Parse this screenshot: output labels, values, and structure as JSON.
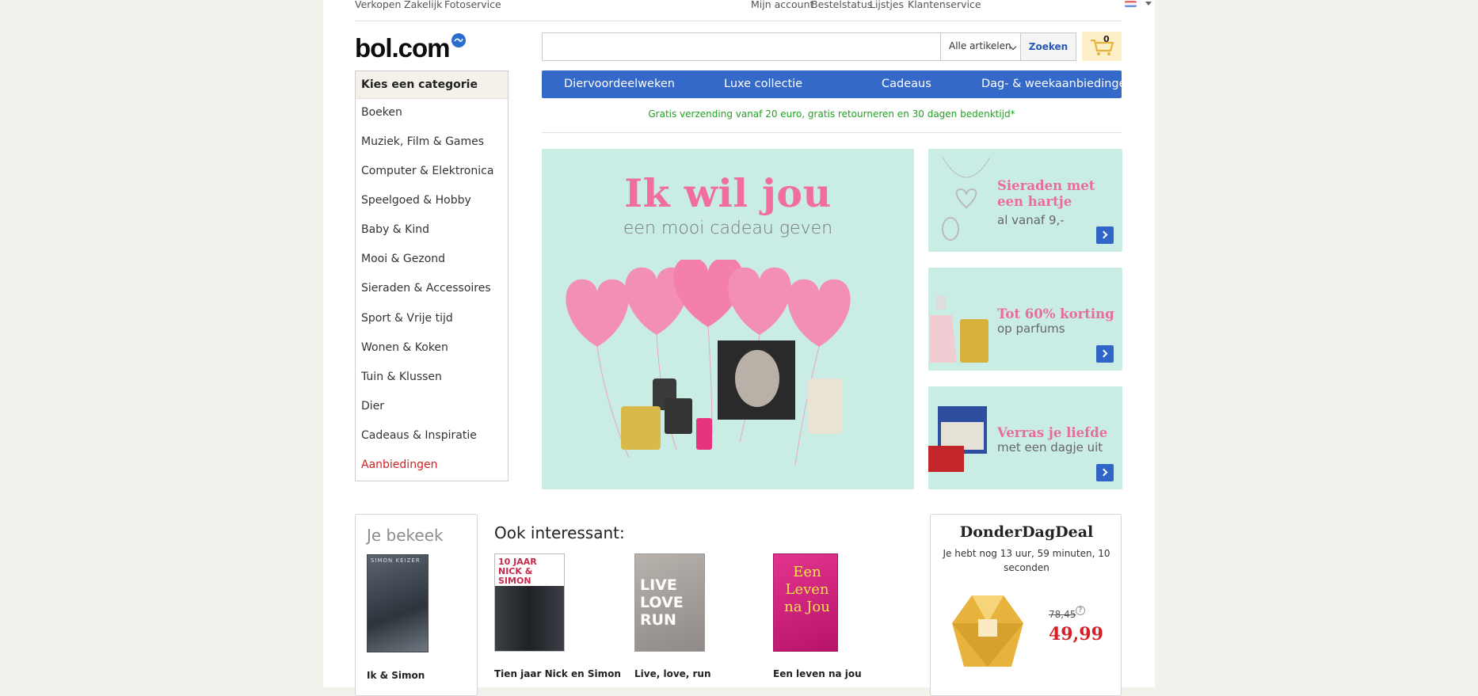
{
  "topbar": {
    "left_links": [
      "Verkopen",
      "Zakelijk",
      "Fotoservice"
    ],
    "right_links": [
      "Mijn account",
      "Bestelstatus",
      "Lijstjes",
      "Klantenservice"
    ],
    "language_icon": "netherlands-flag-icon"
  },
  "logo": {
    "text": "bol.com"
  },
  "search": {
    "placeholder": "",
    "category_select": "Alle artikelen",
    "button_label": "Zoeken"
  },
  "cart": {
    "count": "0",
    "icon": "shopping-cart-icon"
  },
  "category_menu": {
    "title": "Kies een categorie",
    "items": [
      "Boeken",
      "Muziek, Film & Games",
      "Computer & Elektronica",
      "Speelgoed & Hobby",
      "Baby & Kind",
      "Mooi & Gezond",
      "Sieraden & Accessoires",
      "Sport & Vrije tijd",
      "Wonen & Koken",
      "Tuin & Klussen",
      "Dier",
      "Cadeaus & Inspiratie",
      "Aanbiedingen"
    ]
  },
  "nav": {
    "links": [
      "Diervoordeelweken",
      "Luxe collectie",
      "Cadeaus",
      "Dag- & weekaanbiedingen"
    ]
  },
  "shipping_note": "Gratis verzending vanaf 20 euro, gratis retourneren en 30 dagen bedenktijd*",
  "hero": {
    "title": "Ik wil jou",
    "subtitle": "een mooi cadeau geven"
  },
  "promos": [
    {
      "title_line1": "Sieraden met",
      "title_line2": "een hartje",
      "subtitle": "al vanaf 9,-"
    },
    {
      "title_line1": "Tot 60% korting",
      "title_line2": "",
      "subtitle": "op parfums"
    },
    {
      "title_line1": "Verras je liefde",
      "title_line2": "",
      "subtitle": "met een dagje uit"
    }
  ],
  "viewed": {
    "title": "Je bekeek",
    "item": {
      "name": "Ik & Simon",
      "cover_top": "SIMON KEIZER"
    }
  },
  "interesting": {
    "title": "Ook interessant:",
    "items": [
      {
        "name": "Tien jaar Nick en Simon",
        "cover": "10 JAAR NICK & SIMON"
      },
      {
        "name": "Live, love, run",
        "cover": "LIVE LOVE RUN"
      },
      {
        "name": "Een leven na jou",
        "cover": "Een Leven na Jou"
      }
    ]
  },
  "deal": {
    "title": "DonderDagDeal",
    "timer": "Je hebt nog 13 uur, 59 minuten, 10 seconden",
    "old_price": "78,45",
    "new_price": "49,99"
  },
  "colors": {
    "nav_blue": "#3468c9",
    "promo_bg": "#c9ede4",
    "accent_pink": "#ef6e9c",
    "sale_red": "#d61f26",
    "shipping_green": "#23a024"
  }
}
